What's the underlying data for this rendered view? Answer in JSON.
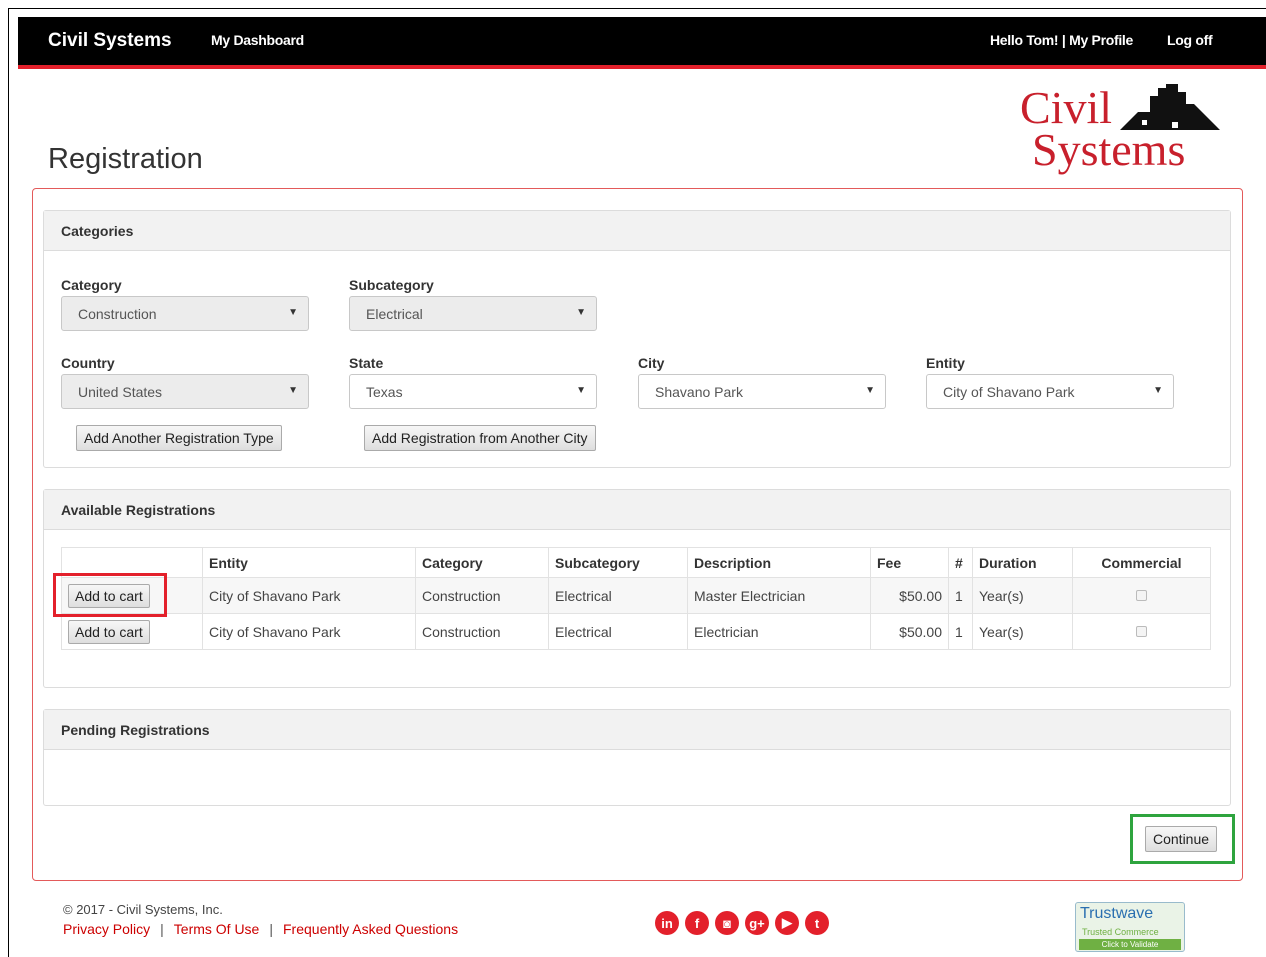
{
  "navbar": {
    "brand": "Civil Systems",
    "dashboard": "My Dashboard",
    "greeting": "Hello Tom! | My Profile",
    "logoff": "Log off"
  },
  "logo": {
    "line1": "Civil",
    "line2": "Systems"
  },
  "page_title": "Registration",
  "categories_panel": {
    "heading": "Categories",
    "category": {
      "label": "Category",
      "value": "Construction"
    },
    "subcategory": {
      "label": "Subcategory",
      "value": "Electrical"
    },
    "country": {
      "label": "Country",
      "value": "United States"
    },
    "state": {
      "label": "State",
      "value": "Texas"
    },
    "city": {
      "label": "City",
      "value": "Shavano Park"
    },
    "entity": {
      "label": "Entity",
      "value": "City of Shavano Park"
    },
    "add_type_button": "Add Another Registration Type",
    "add_city_button": "Add Registration from Another City"
  },
  "available_panel": {
    "heading": "Available Registrations",
    "columns": [
      "Entity",
      "Category",
      "Subcategory",
      "Description",
      "Fee",
      "#",
      "Duration",
      "Commercial"
    ],
    "add_button": "Add to cart",
    "rows": [
      {
        "entity": "City of Shavano Park",
        "category": "Construction",
        "subcategory": "Electrical",
        "description": "Master Electrician",
        "fee": "$50.00",
        "num": "1",
        "duration": "Year(s)"
      },
      {
        "entity": "City of Shavano Park",
        "category": "Construction",
        "subcategory": "Electrical",
        "description": "Electrician",
        "fee": "$50.00",
        "num": "1",
        "duration": "Year(s)"
      }
    ]
  },
  "pending_panel": {
    "heading": "Pending Registrations"
  },
  "continue_button": "Continue",
  "footer": {
    "copyright": "© 2017 - Civil Systems, Inc.",
    "privacy": "Privacy Policy",
    "terms": "Terms Of Use",
    "faq": "Frequently Asked Questions",
    "separator": "|",
    "social": [
      "linkedin-icon",
      "facebook-icon",
      "instagram-icon",
      "google-plus-icon",
      "youtube-icon",
      "twitter-icon"
    ],
    "trust_title": "Trustwave",
    "trust_sub": "Trusted Commerce",
    "trust_cta": "Click to Validate"
  },
  "colors": {
    "accent_red": "#e3202b",
    "highlight_green": "#2ea43e",
    "navbar": "#000000"
  }
}
